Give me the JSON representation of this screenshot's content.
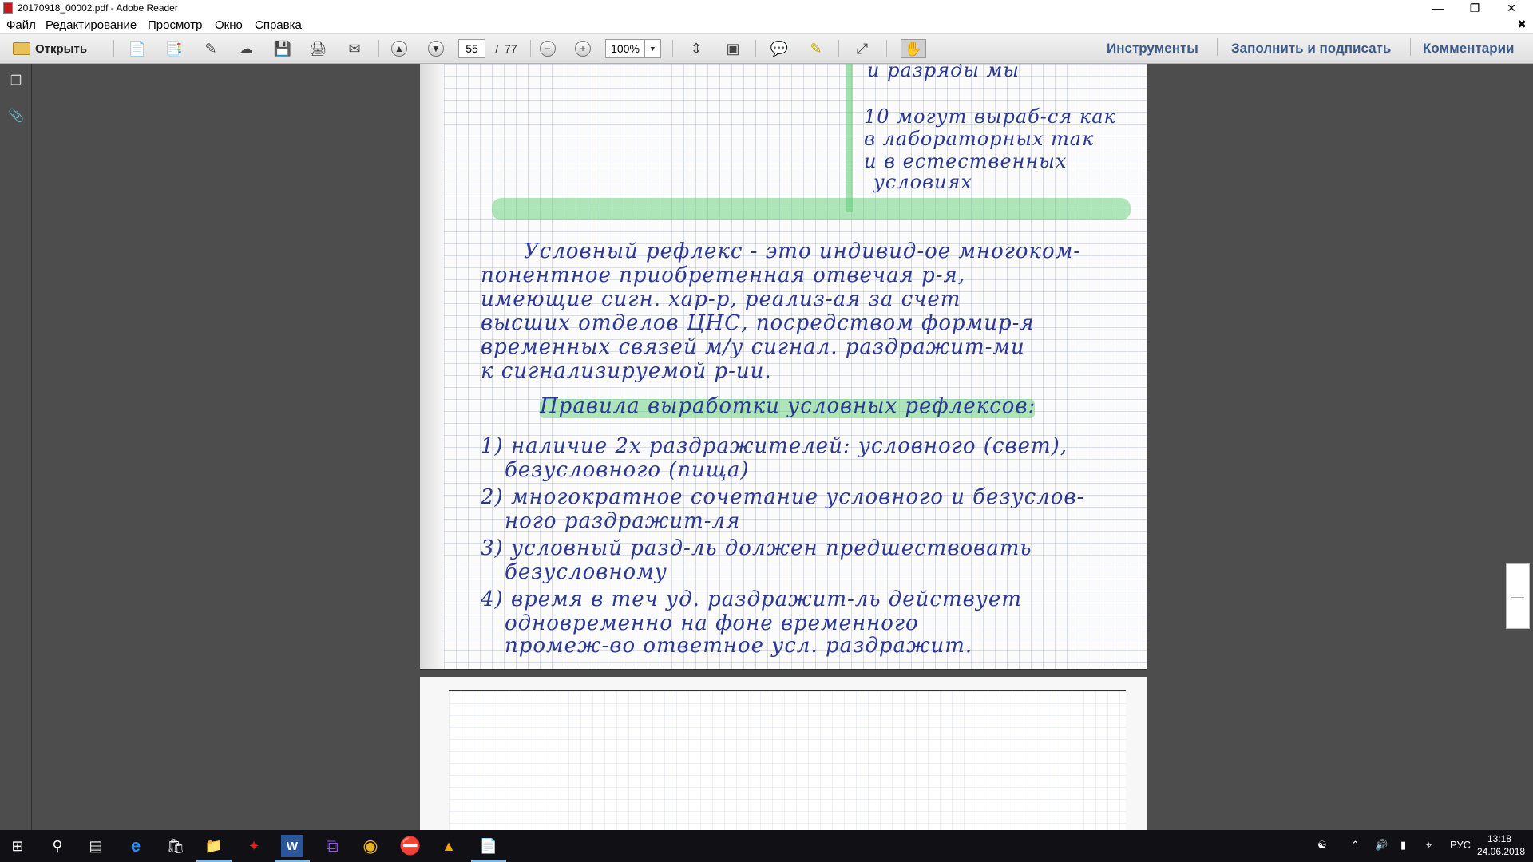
{
  "window": {
    "title": "20170918_00002.pdf - Adobe Reader"
  },
  "menu": [
    "Файл",
    "Редактирование",
    "Просмотр",
    "Окно",
    "Справка"
  ],
  "toolbar": {
    "open_label": "Открыть",
    "page_current": "55",
    "page_sep": "/",
    "page_total": "77",
    "zoom": "100%",
    "tools_label": "Инструменты",
    "fill_sign_label": "Заполнить и подписать",
    "comments_label": "Комментарии"
  },
  "document": {
    "top_line": "и разряды мы",
    "note_block": [
      "10 могут выраб-ся как",
      "в лабораторных так",
      "и в естественных",
      "условиях"
    ],
    "paragraph": [
      "Условный рефлекс - это индивид-ое многоком-",
      "понентное приобретенная отвечая р-я,",
      "имеющие сигн. хар-р, реализ-ая за счет",
      "высших отделов ЦНС, посредством формир-я",
      "временных связей м/у сигнал. раздражит-ми",
      "к сигнализируемой р-ии."
    ],
    "heading": "Правила выработки условных рефлексов:",
    "rules": [
      "1) наличие 2х раздражителей: условного (свет),",
      "безусловного (пища)",
      "2) многократное сочетание условного и безуслов-",
      "ного раздражит-ля",
      "3) условный разд-ль должен предшествовать",
      "безусловному",
      "4) время в теч уд. раздражит-ль действует",
      "одновременно на фоне временного",
      "промеж-во ответное усл. раздражит."
    ]
  },
  "taskbar": {
    "tray_lang": "РУС",
    "time": "13:18",
    "date": "24.06.2018"
  }
}
